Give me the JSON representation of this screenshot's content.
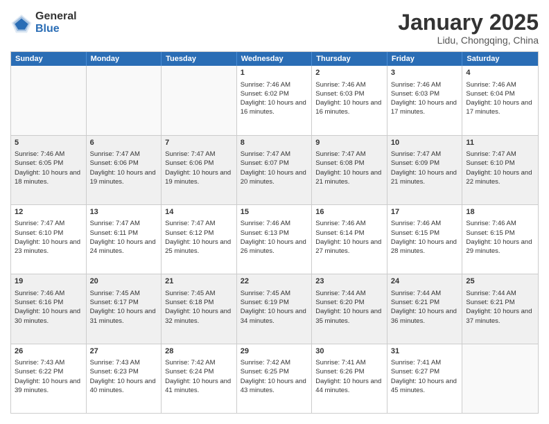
{
  "logo": {
    "general": "General",
    "blue": "Blue"
  },
  "header": {
    "month": "January 2025",
    "location": "Lidu, Chongqing, China"
  },
  "days": [
    "Sunday",
    "Monday",
    "Tuesday",
    "Wednesday",
    "Thursday",
    "Friday",
    "Saturday"
  ],
  "weeks": [
    [
      {
        "num": "",
        "content": "",
        "empty": true
      },
      {
        "num": "",
        "content": "",
        "empty": true
      },
      {
        "num": "",
        "content": "",
        "empty": true
      },
      {
        "num": "1",
        "content": "Sunrise: 7:46 AM\nSunset: 6:02 PM\nDaylight: 10 hours and 16 minutes.",
        "empty": false
      },
      {
        "num": "2",
        "content": "Sunrise: 7:46 AM\nSunset: 6:03 PM\nDaylight: 10 hours and 16 minutes.",
        "empty": false
      },
      {
        "num": "3",
        "content": "Sunrise: 7:46 AM\nSunset: 6:03 PM\nDaylight: 10 hours and 17 minutes.",
        "empty": false
      },
      {
        "num": "4",
        "content": "Sunrise: 7:46 AM\nSunset: 6:04 PM\nDaylight: 10 hours and 17 minutes.",
        "empty": false
      }
    ],
    [
      {
        "num": "5",
        "content": "Sunrise: 7:46 AM\nSunset: 6:05 PM\nDaylight: 10 hours and 18 minutes.",
        "empty": false
      },
      {
        "num": "6",
        "content": "Sunrise: 7:47 AM\nSunset: 6:06 PM\nDaylight: 10 hours and 19 minutes.",
        "empty": false
      },
      {
        "num": "7",
        "content": "Sunrise: 7:47 AM\nSunset: 6:06 PM\nDaylight: 10 hours and 19 minutes.",
        "empty": false
      },
      {
        "num": "8",
        "content": "Sunrise: 7:47 AM\nSunset: 6:07 PM\nDaylight: 10 hours and 20 minutes.",
        "empty": false
      },
      {
        "num": "9",
        "content": "Sunrise: 7:47 AM\nSunset: 6:08 PM\nDaylight: 10 hours and 21 minutes.",
        "empty": false
      },
      {
        "num": "10",
        "content": "Sunrise: 7:47 AM\nSunset: 6:09 PM\nDaylight: 10 hours and 21 minutes.",
        "empty": false
      },
      {
        "num": "11",
        "content": "Sunrise: 7:47 AM\nSunset: 6:10 PM\nDaylight: 10 hours and 22 minutes.",
        "empty": false
      }
    ],
    [
      {
        "num": "12",
        "content": "Sunrise: 7:47 AM\nSunset: 6:10 PM\nDaylight: 10 hours and 23 minutes.",
        "empty": false
      },
      {
        "num": "13",
        "content": "Sunrise: 7:47 AM\nSunset: 6:11 PM\nDaylight: 10 hours and 24 minutes.",
        "empty": false
      },
      {
        "num": "14",
        "content": "Sunrise: 7:47 AM\nSunset: 6:12 PM\nDaylight: 10 hours and 25 minutes.",
        "empty": false
      },
      {
        "num": "15",
        "content": "Sunrise: 7:46 AM\nSunset: 6:13 PM\nDaylight: 10 hours and 26 minutes.",
        "empty": false
      },
      {
        "num": "16",
        "content": "Sunrise: 7:46 AM\nSunset: 6:14 PM\nDaylight: 10 hours and 27 minutes.",
        "empty": false
      },
      {
        "num": "17",
        "content": "Sunrise: 7:46 AM\nSunset: 6:15 PM\nDaylight: 10 hours and 28 minutes.",
        "empty": false
      },
      {
        "num": "18",
        "content": "Sunrise: 7:46 AM\nSunset: 6:15 PM\nDaylight: 10 hours and 29 minutes.",
        "empty": false
      }
    ],
    [
      {
        "num": "19",
        "content": "Sunrise: 7:46 AM\nSunset: 6:16 PM\nDaylight: 10 hours and 30 minutes.",
        "empty": false
      },
      {
        "num": "20",
        "content": "Sunrise: 7:45 AM\nSunset: 6:17 PM\nDaylight: 10 hours and 31 minutes.",
        "empty": false
      },
      {
        "num": "21",
        "content": "Sunrise: 7:45 AM\nSunset: 6:18 PM\nDaylight: 10 hours and 32 minutes.",
        "empty": false
      },
      {
        "num": "22",
        "content": "Sunrise: 7:45 AM\nSunset: 6:19 PM\nDaylight: 10 hours and 34 minutes.",
        "empty": false
      },
      {
        "num": "23",
        "content": "Sunrise: 7:44 AM\nSunset: 6:20 PM\nDaylight: 10 hours and 35 minutes.",
        "empty": false
      },
      {
        "num": "24",
        "content": "Sunrise: 7:44 AM\nSunset: 6:21 PM\nDaylight: 10 hours and 36 minutes.",
        "empty": false
      },
      {
        "num": "25",
        "content": "Sunrise: 7:44 AM\nSunset: 6:21 PM\nDaylight: 10 hours and 37 minutes.",
        "empty": false
      }
    ],
    [
      {
        "num": "26",
        "content": "Sunrise: 7:43 AM\nSunset: 6:22 PM\nDaylight: 10 hours and 39 minutes.",
        "empty": false
      },
      {
        "num": "27",
        "content": "Sunrise: 7:43 AM\nSunset: 6:23 PM\nDaylight: 10 hours and 40 minutes.",
        "empty": false
      },
      {
        "num": "28",
        "content": "Sunrise: 7:42 AM\nSunset: 6:24 PM\nDaylight: 10 hours and 41 minutes.",
        "empty": false
      },
      {
        "num": "29",
        "content": "Sunrise: 7:42 AM\nSunset: 6:25 PM\nDaylight: 10 hours and 43 minutes.",
        "empty": false
      },
      {
        "num": "30",
        "content": "Sunrise: 7:41 AM\nSunset: 6:26 PM\nDaylight: 10 hours and 44 minutes.",
        "empty": false
      },
      {
        "num": "31",
        "content": "Sunrise: 7:41 AM\nSunset: 6:27 PM\nDaylight: 10 hours and 45 minutes.",
        "empty": false
      },
      {
        "num": "",
        "content": "",
        "empty": true
      }
    ]
  ]
}
